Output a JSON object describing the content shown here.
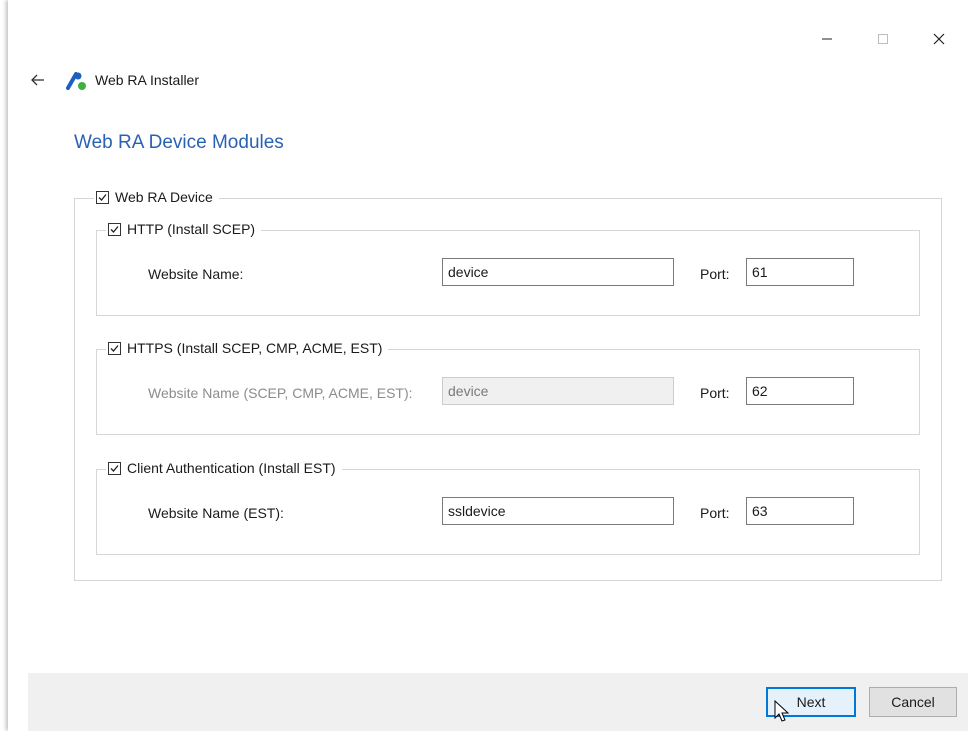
{
  "window": {
    "title": "Web RA Installer",
    "controls": {
      "minimize": "minimize-icon",
      "maximize": "maximize-icon",
      "close": "close-icon"
    }
  },
  "page": {
    "heading": "Web RA Device Modules"
  },
  "groups": {
    "main": {
      "label": "Web RA Device",
      "checked": true
    },
    "http": {
      "label": "HTTP (Install SCEP)",
      "checked": true,
      "website_label": "Website Name:",
      "website_value": "device",
      "port_label": "Port:",
      "port_value": "61"
    },
    "https": {
      "label": "HTTPS (Install SCEP, CMP, ACME, EST)",
      "checked": true,
      "website_label": "Website Name (SCEP, CMP, ACME, EST):",
      "website_value": "device",
      "port_label": "Port:",
      "port_value": "62"
    },
    "client_auth": {
      "label": "Client Authentication (Install EST)",
      "checked": true,
      "website_label": "Website Name (EST):",
      "website_value": "ssldevice",
      "port_label": "Port:",
      "port_value": "63"
    }
  },
  "footer": {
    "next_label": "Next",
    "cancel_label": "Cancel"
  },
  "colors": {
    "accent": "#2a62b3",
    "focus_border": "#0078d7",
    "logo_blue": "#1f5fbf",
    "logo_green": "#3cb043"
  }
}
